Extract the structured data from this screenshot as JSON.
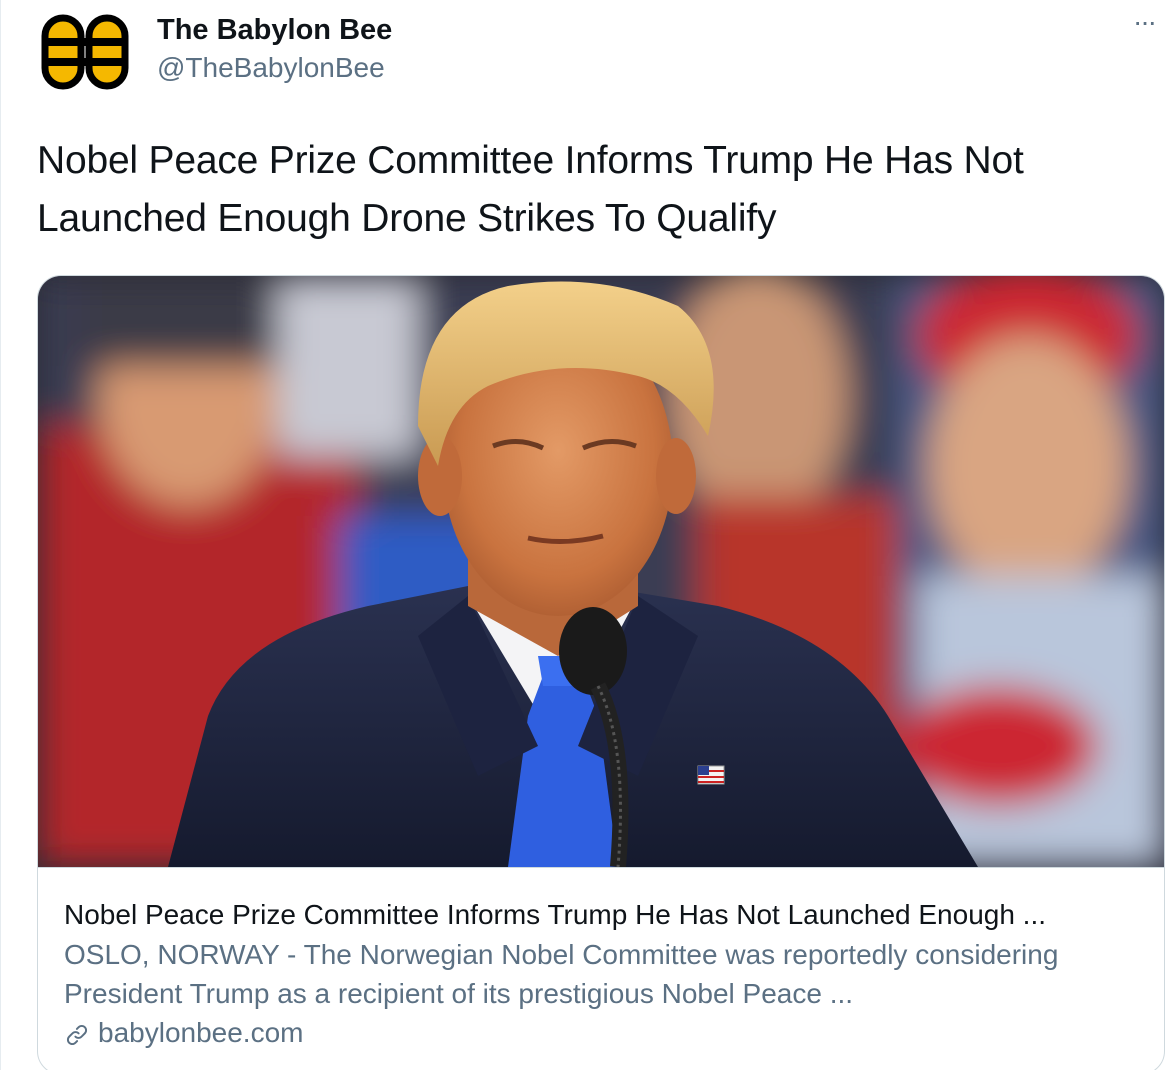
{
  "tweet": {
    "author_name": "The Babylon Bee",
    "author_handle": "@TheBabylonBee",
    "more_label": "···",
    "text": "Nobel Peace Prize Committee Informs Trump He Has Not Launched Enough Drone Strikes To Qualify"
  },
  "card": {
    "title": "Nobel Peace Prize Committee Informs Trump He Has Not Launched Enough ...",
    "description": "OSLO, NORWAY - The Norwegian Nobel Committee was reportedly considering President Trump as a recipient of its prestigious Nobel Peace ...",
    "domain": "babylonbee.com",
    "image_icon": "news-photo",
    "link_icon": "link-icon"
  },
  "icons": {
    "avatar": "babylon-bee-logo-icon",
    "more": "more-options-icon"
  },
  "colors": {
    "text_primary": "#0f1419",
    "text_secondary": "#5b7083",
    "border": "#cfd9de",
    "brand_yellow": "#f5b800"
  }
}
